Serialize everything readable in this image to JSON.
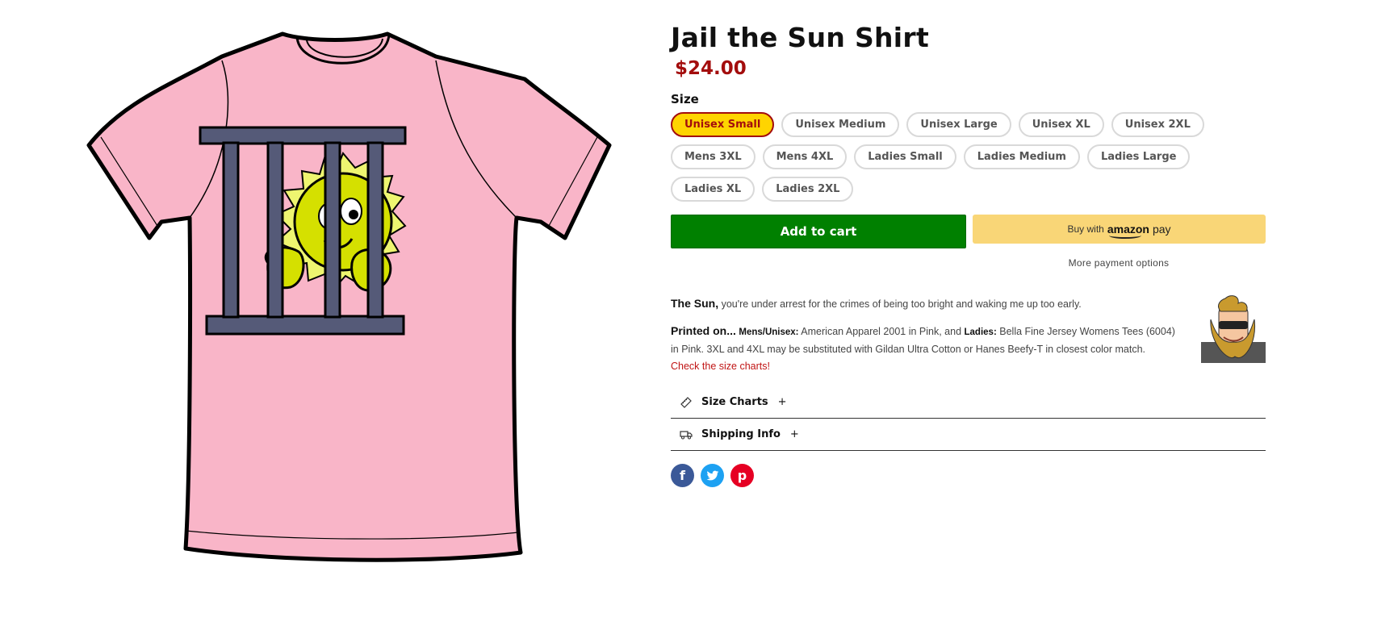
{
  "product": {
    "title": "Jail the Sun Shirt",
    "price": "$24.00",
    "image_alt": "Pink t-shirt with a sun behind jail bars",
    "shirt_color": "#f9b5c8"
  },
  "size": {
    "label": "Size",
    "selected": "Unisex Small",
    "options": [
      "Unisex Small",
      "Unisex Medium",
      "Unisex Large",
      "Unisex XL",
      "Unisex 2XL",
      "Mens 3XL",
      "Mens 4XL",
      "Ladies Small",
      "Ladies Medium",
      "Ladies Large",
      "Ladies XL",
      "Ladies 2XL"
    ]
  },
  "actions": {
    "add_to_cart": "Add to cart",
    "buy_with": "Buy with",
    "amazon": "amazon",
    "pay": "pay",
    "more_payment": "More payment options"
  },
  "description": {
    "lead": "The Sun,",
    "lead_rest": " you're under arrest for the crimes of being too bright and waking me up too early.",
    "printed_on": "Printed on...",
    "mens_label": "Mens/Unisex:",
    "mens_text": " American Apparel 2001 in Pink, and ",
    "ladies_label": "Ladies:",
    "ladies_text": " Bella Fine Jersey Womens Tees (6004) in Pink. 3XL and 4XL may be substituted with Gildan Ultra Cotton or Hanes Beefy-T in closest color match.",
    "size_chart_link": "Check the size charts!"
  },
  "accordion": {
    "size_charts": "Size Charts",
    "shipping": "Shipping Info",
    "plus": "+"
  },
  "social": {
    "facebook": "f",
    "twitter": "t",
    "pinterest": "p"
  },
  "colors": {
    "price": "#a30d0d",
    "selected_bg": "#ffd400",
    "cart_green": "#008000",
    "amazon_yellow": "#f9d677"
  }
}
